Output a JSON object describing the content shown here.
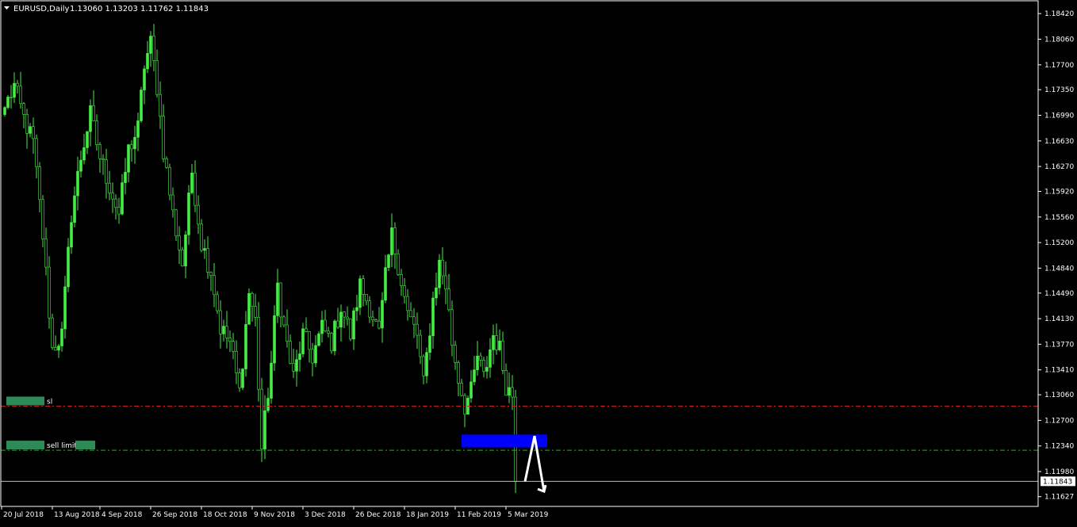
{
  "chart_data": {
    "type": "candlestick",
    "title": "EURUSD,Daily",
    "ohlc": "1.13060 1.13203 1.11762 1.11843",
    "ylim": [
      1.1149,
      1.186
    ],
    "y_ticks": [
      "1.18420",
      "1.18060",
      "1.17700",
      "1.17350",
      "1.16990",
      "1.16630",
      "1.16270",
      "1.15920",
      "1.15560",
      "1.15200",
      "1.14840",
      "1.14490",
      "1.14130",
      "1.13770",
      "1.13410",
      "1.13060",
      "1.12700",
      "1.12340",
      "1.11980",
      "1.11627"
    ],
    "x_ticks": [
      {
        "label": "20 Jul 2018",
        "index": 0
      },
      {
        "label": "13 Aug 2018",
        "index": 16
      },
      {
        "label": "4 Sep 2018",
        "index": 31
      },
      {
        "label": "26 Sep 2018",
        "index": 47
      },
      {
        "label": "18 Oct 2018",
        "index": 63
      },
      {
        "label": "9 Nov 2018",
        "index": 79
      },
      {
        "label": "3 Dec 2018",
        "index": 95
      },
      {
        "label": "26 Dec 2018",
        "index": 111
      },
      {
        "label": "18 Jan 2019",
        "index": 127
      },
      {
        "label": "11 Feb 2019",
        "index": 143
      },
      {
        "label": "5 Mar 2019",
        "index": 159
      }
    ],
    "price_path": [
      [
        0,
        1.171
      ],
      [
        3,
        1.174
      ],
      [
        6,
        1.1695
      ],
      [
        9,
        1.166
      ],
      [
        12,
        1.153
      ],
      [
        15,
        1.137
      ],
      [
        18,
        1.139
      ],
      [
        21,
        1.156
      ],
      [
        24,
        1.164
      ],
      [
        27,
        1.17
      ],
      [
        30,
        1.164
      ],
      [
        33,
        1.16
      ],
      [
        36,
        1.156
      ],
      [
        39,
        1.165
      ],
      [
        42,
        1.168
      ],
      [
        44,
        1.177
      ],
      [
        46,
        1.18
      ],
      [
        48,
        1.174
      ],
      [
        50,
        1.165
      ],
      [
        53,
        1.156
      ],
      [
        56,
        1.149
      ],
      [
        59,
        1.162
      ],
      [
        62,
        1.152
      ],
      [
        65,
        1.148
      ],
      [
        68,
        1.14
      ],
      [
        71,
        1.138
      ],
      [
        74,
        1.131
      ],
      [
        77,
        1.145
      ],
      [
        79,
        1.141
      ],
      [
        81,
        1.123
      ],
      [
        84,
        1.135
      ],
      [
        86,
        1.146
      ],
      [
        88,
        1.14
      ],
      [
        91,
        1.133
      ],
      [
        94,
        1.139
      ],
      [
        97,
        1.136
      ],
      [
        100,
        1.14
      ],
      [
        103,
        1.138
      ],
      [
        106,
        1.143
      ],
      [
        109,
        1.139
      ],
      [
        112,
        1.146
      ],
      [
        115,
        1.143
      ],
      [
        118,
        1.139
      ],
      [
        120,
        1.147
      ],
      [
        122,
        1.153
      ],
      [
        124,
        1.149
      ],
      [
        127,
        1.142
      ],
      [
        130,
        1.139
      ],
      [
        132,
        1.132
      ],
      [
        135,
        1.144
      ],
      [
        137,
        1.149
      ],
      [
        139,
        1.146
      ],
      [
        141,
        1.138
      ],
      [
        143,
        1.133
      ],
      [
        145,
        1.129
      ],
      [
        147,
        1.131
      ],
      [
        149,
        1.136
      ],
      [
        151,
        1.133
      ],
      [
        154,
        1.139
      ],
      [
        156,
        1.137
      ],
      [
        158,
        1.132
      ],
      [
        160,
        1.1306
      ],
      [
        161,
        1.1184
      ]
    ],
    "bar_count": 162,
    "lines": [
      {
        "name": "sl",
        "value": 1.129,
        "color": "#cc2222",
        "style": "dash-dot"
      },
      {
        "name": "sell limit",
        "value": 1.1228,
        "color": "#33aa33",
        "style": "dash-dot"
      },
      {
        "value": 1.11843,
        "color": "#bbbbbb",
        "style": "solid"
      }
    ],
    "zone": {
      "from_index": 144,
      "to_index": 171,
      "low": 1.1232,
      "high": 1.125,
      "color": "#0000ff"
    },
    "arrow": {
      "color": "#ffffff",
      "points": [
        [
          164,
          1.1184
        ],
        [
          167,
          1.1248
        ],
        [
          170,
          1.117
        ]
      ]
    },
    "last_price": "1.11843",
    "bull_color": "#44ee44",
    "bear_color": "#000000",
    "wick_color": "#44ee44",
    "axis_color": "#ffffff",
    "label_box_color": "#2e8b57",
    "grid": false
  }
}
